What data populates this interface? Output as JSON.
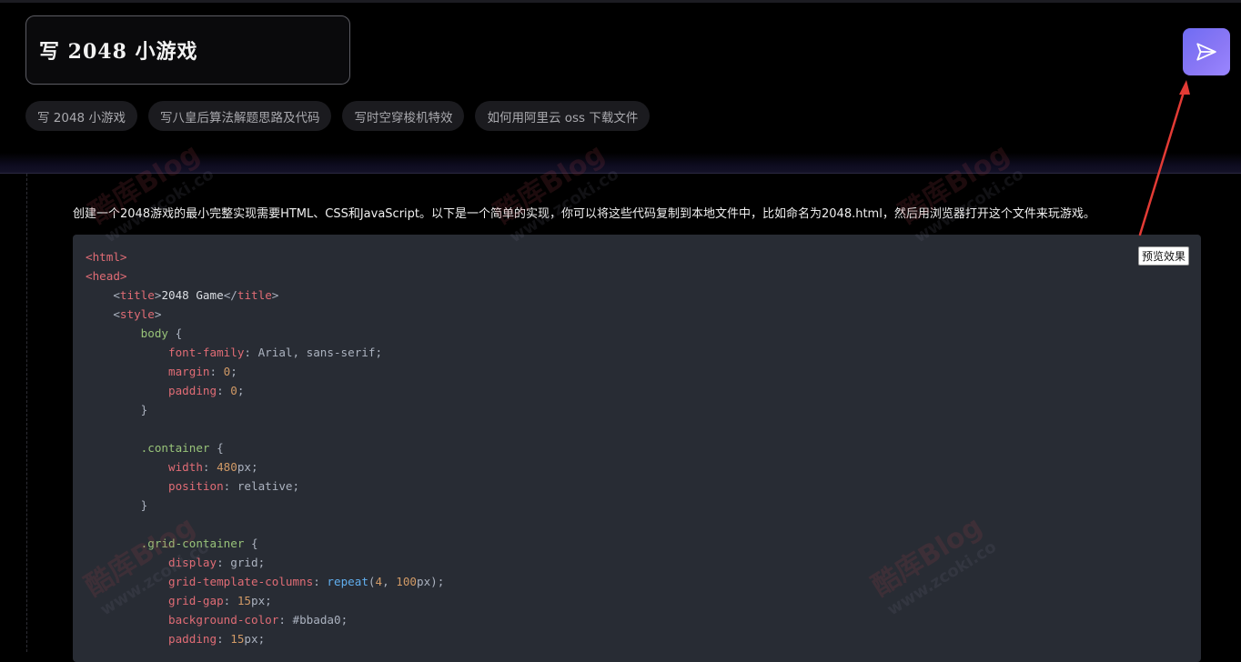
{
  "prompt": {
    "text": "写 2048 小游戏"
  },
  "suggestions": [
    {
      "label": "写 2048 小游戏"
    },
    {
      "label": "写八皇后算法解题思路及代码"
    },
    {
      "label": "写时空穿梭机特效"
    },
    {
      "label": "如何用阿里云 oss 下载文件"
    }
  ],
  "response": {
    "intro": "创建一个2048游戏的最小完整实现需要HTML、CSS和JavaScript。以下是一个简单的实现，你可以将这些代码复制到本地文件中，比如命名为2048.html，然后用浏览器打开这个文件来玩游戏。",
    "preview_label": "预览效果",
    "code_lines": [
      "<html>",
      "<head>",
      "    <title>2048 Game</title>",
      "    <style>",
      "        body {",
      "            font-family: Arial, sans-serif;",
      "            margin: 0;",
      "            padding: 0;",
      "        }",
      "",
      "        .container {",
      "            width: 480px;",
      "            position: relative;",
      "        }",
      "",
      "        .grid-container {",
      "            display: grid;",
      "            grid-template-columns: repeat(4, 100px);",
      "            grid-gap: 15px;",
      "            background-color: #bbada0;",
      "            padding: 15px;"
    ]
  },
  "watermarks": [
    "酷库Blog",
    "酷库Blog",
    "酷库Blog",
    "酷库Blog",
    "酷库Blog"
  ],
  "watermark_url": "www.zcoki.co",
  "icons": {
    "send": "send-icon"
  },
  "colors": {
    "accent": "#7b6ff3",
    "annotation_arrow": "#e33b35"
  }
}
